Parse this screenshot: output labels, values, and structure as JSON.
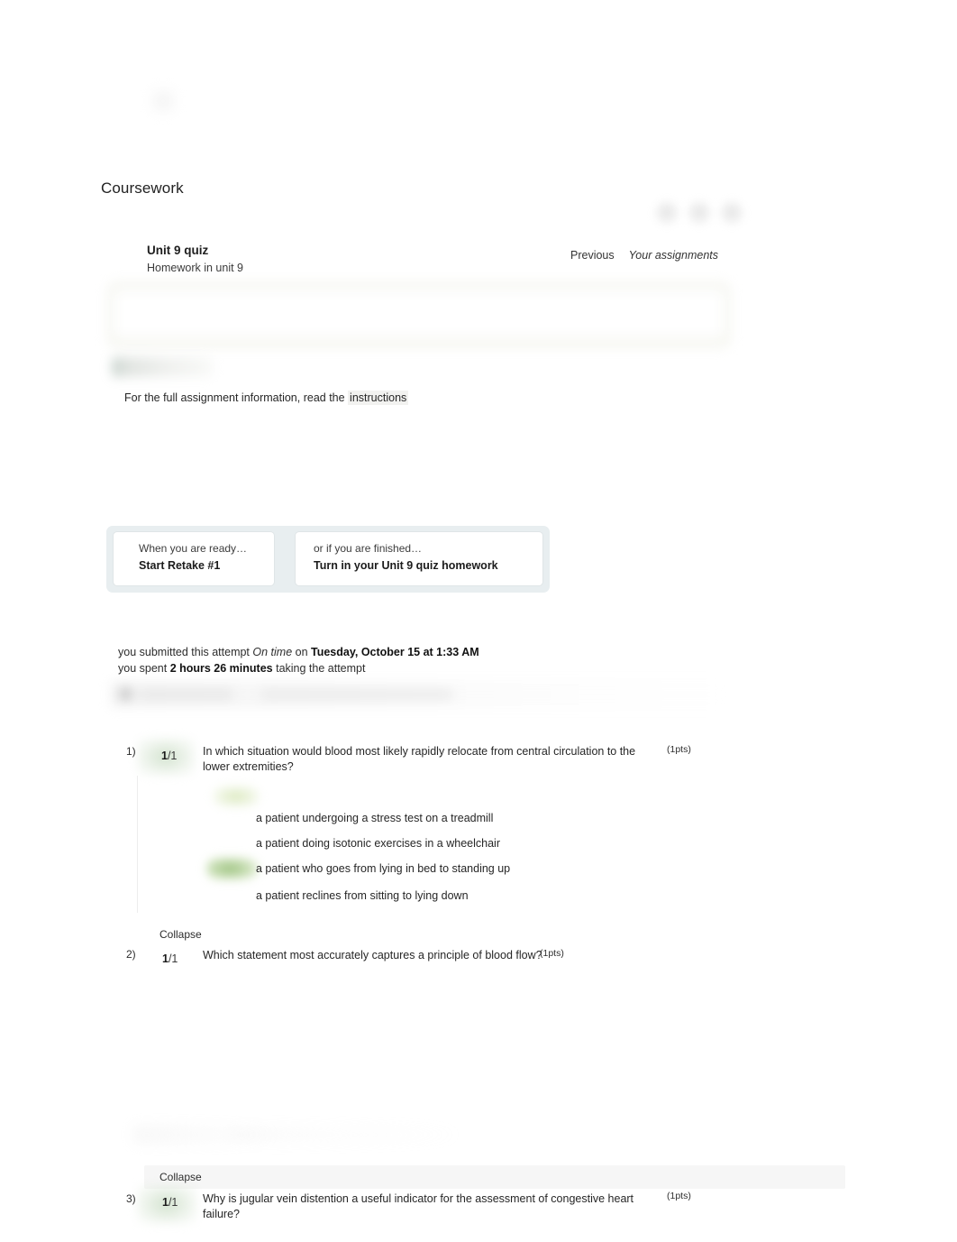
{
  "page": {
    "title": "Coursework",
    "top_glyph_icon": "faded-logo-icon"
  },
  "header": {
    "assignment_title": "Unit 9 quiz",
    "assignment_subtitle": "Homework in unit 9",
    "links": [
      {
        "label": "Previous",
        "style": "normal",
        "name": "previous-link"
      },
      {
        "label": "Your assignments",
        "style": "italic",
        "name": "your-assignments-link"
      }
    ],
    "avatars": [
      "avatar-1",
      "avatar-2",
      "avatar-3"
    ]
  },
  "instructions": {
    "prefix": "For the full assignment information, read the ",
    "link_label": "instructions"
  },
  "actions": {
    "left": {
      "kicker": "When you are ready…",
      "main": "Start Retake #1"
    },
    "right": {
      "kicker": "or if you are finished…",
      "main": "Turn in your Unit 9 quiz homework"
    }
  },
  "submission": {
    "line1_pre": "you submitted this attempt ",
    "line1_status": "On time",
    "line1_mid": " on ",
    "line1_datetime": "Tuesday, October 15 at 1:33 AM",
    "line2_pre": "you spent ",
    "line2_duration": "2 hours 26 minutes",
    "line2_post": " taking the attempt"
  },
  "questions": [
    {
      "index": "1)",
      "score_earned": "1",
      "score_total": "/1",
      "text": "In which situation would blood most likely rapidly relocate from central circulation to the lower extremities?",
      "points": "(1pts)",
      "collapse_label": "Collapse",
      "options": [
        {
          "label": "a patient undergoing a stress test on a treadmill",
          "marked": "pale"
        },
        {
          "label": "a patient doing isotonic exercises in a wheelchair",
          "marked": "none"
        },
        {
          "label": "a patient who goes from lying in bed to standing up",
          "marked": "green"
        },
        {
          "label": "a patient reclines from sitting to lying down",
          "marked": "none"
        }
      ]
    },
    {
      "index": "2)",
      "score_earned": "1",
      "score_total": "/1",
      "text": "Which statement most accurately captures a principle of blood flow?",
      "points": "(1pts)",
      "collapse_label": "Collapse"
    },
    {
      "index": "3)",
      "score_earned": "1",
      "score_total": "/1",
      "text": "Why is jugular vein distention a useful indicator for the assessment of congestive heart failure?",
      "points": "(1pts)"
    }
  ],
  "colors": {
    "panel_green": "#f1f2ea",
    "action_bar_blue": "#e8eef0",
    "correct_green": "#96be78",
    "text": "#262626"
  }
}
